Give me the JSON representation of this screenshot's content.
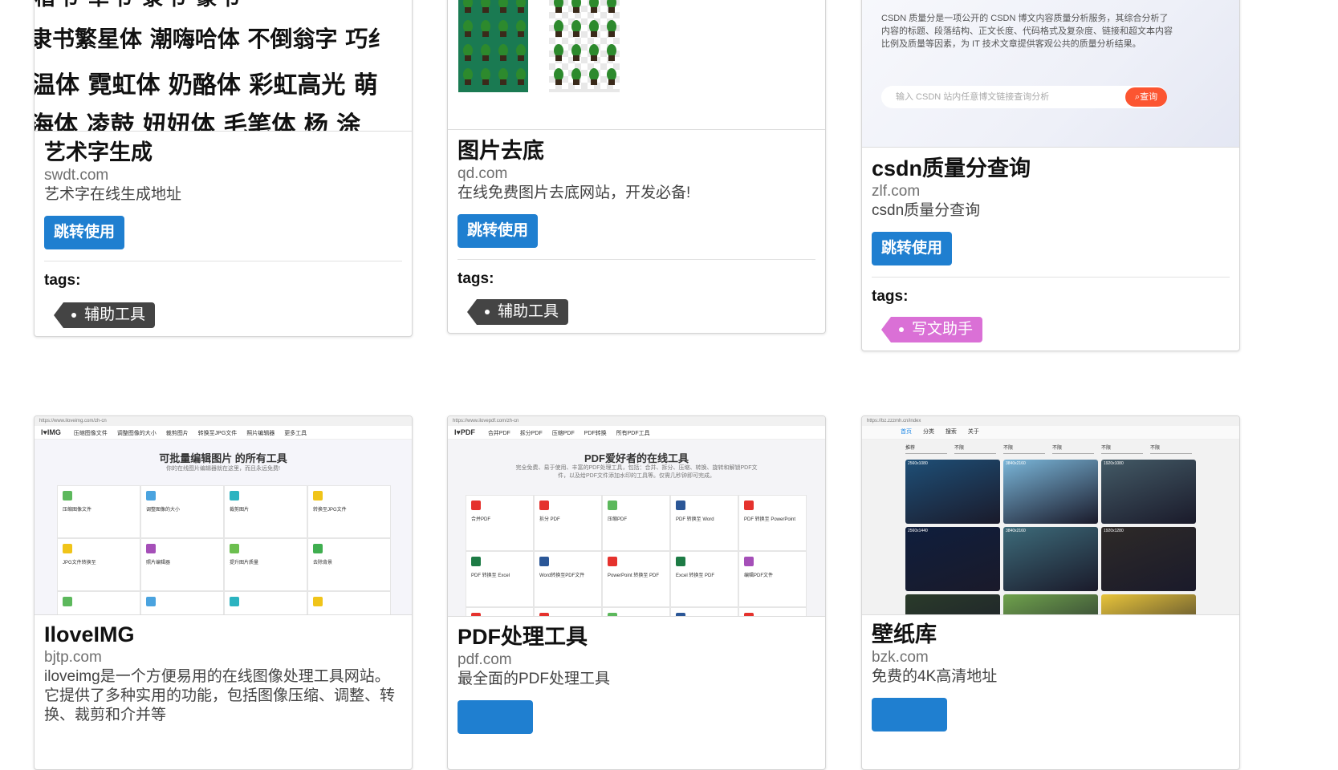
{
  "cards": [
    {
      "title": "艺术字生成",
      "domain": "swdt.com",
      "description": "艺术字在线生成地址",
      "button_label": "跳转使用",
      "tags_label": "tags:",
      "tag": "辅助工具",
      "thumbnail": {
        "rows": [
          "楷书 草书 隶书 篆书",
          "隶书繁星体 潮嗨哈体 不倒翁字 巧纟",
          "温体 霓虹体 奶酪体 彩虹高光 萌",
          "海体 凌鼓 妞妞体 毛笔体 杨 涂"
        ]
      }
    },
    {
      "title": "图片去底",
      "domain": "qd.com",
      "description": "在线免费图片去底网站，开发必备!",
      "button_label": "跳转使用",
      "tags_label": "tags:",
      "tag": "辅助工具"
    },
    {
      "title": "csdn质量分查询",
      "domain": "zlf.com",
      "description": "csdn质量分查询",
      "button_label": "跳转使用",
      "tags_label": "tags:",
      "tag": "写文助手",
      "thumbnail": {
        "intro": "CSDN 质量分是一项公开的 CSDN 博文内容质量分析服务，其综合分析了内容的标题、段落结构、正文长度、代码格式及复杂度、链接和超文本内容比例及质量等因素，为 IT 技术文章提供客观公共的质量分析结果。",
        "search_placeholder": "输入 CSDN 站内任意博文链接查询分析",
        "search_button": "查询"
      }
    },
    {
      "title": "IloveIMG",
      "domain": "bjtp.com",
      "description": "iloveimg是一个方便易用的在线图像处理工具网站。它提供了多种实用的功能，包括图像压缩、调整、转换、裁剪和介并等",
      "thumbnail": {
        "url": "https://www.iloveimg.com/zh-cn",
        "logo": "I♥IMG",
        "nav": [
          "压缩图像文件",
          "调整图像的大小",
          "裁剪图片",
          "转换至JPG文件",
          "照片编辑器",
          "更多工具"
        ],
        "heading": "可批量编辑图片 的所有工具",
        "subheading": "你的在线图片编辑器就在这里，而且永远免费!",
        "tiles": [
          "压缩图像文件",
          "调整图像的大小",
          "裁剪图片",
          "转换至JPG文件",
          "JPG文件转换至",
          "照片编辑器",
          "提升图片质量",
          "去除背景"
        ]
      }
    },
    {
      "title": "PDF处理工具",
      "domain": "pdf.com",
      "description": "最全面的PDF处理工具",
      "thumbnail": {
        "url": "https://www.ilovepdf.com/zh-cn",
        "logo": "I♥PDF",
        "nav": [
          "合并PDF",
          "拆分PDF",
          "压缩PDF",
          "PDF转换",
          "所有PDF工具"
        ],
        "heading": "PDF爱好者的在线工具",
        "subheading": "完全免费、易于使用、丰富的PDF处理工具，包括：合并、拆分、压缩、转换、旋转和解锁PDF文件，以及给PDF文件添加水印的工具等。仅需几秒钟即可完成。",
        "tiles": [
          "合并PDF",
          "拆分 PDF",
          "压缩PDF",
          "PDF 转换至 Word",
          "PDF 转换至 PowerPoint",
          "PDF 转换至 Excel",
          "Word转换至PDF文件",
          "PowerPoint 转换至 PDF",
          "Excel 转换至 PDF",
          "编辑PDF文件"
        ]
      }
    },
    {
      "title": "壁纸库",
      "domain": "bzk.com",
      "description": "免费的4K高清地址",
      "thumbnail": {
        "url": "https://bz.zzzmh.cn/index",
        "nav": [
          "首页",
          "分类",
          "搜索",
          "关于"
        ],
        "filters": [
          "推荐",
          "不限",
          "不限",
          "不限",
          "不限",
          "不限"
        ],
        "resolutions": [
          "2560x1080",
          "3840x2160",
          "1920x1080",
          "2560x1440",
          "3840x2160",
          "1920x1280"
        ],
        "colors": [
          "#1e4f77",
          "#7ab6d9",
          "#435a66",
          "#0f1e3d",
          "#3d6b7a",
          "#2e2a28",
          "#2a3b2a",
          "#6fa24c",
          "#e8c43a"
        ]
      }
    }
  ],
  "colors": {
    "button": "#1f7fd0",
    "tag_dark": "#444444",
    "tag_pink": "#da70d6",
    "accent_red": "#e5322d"
  }
}
